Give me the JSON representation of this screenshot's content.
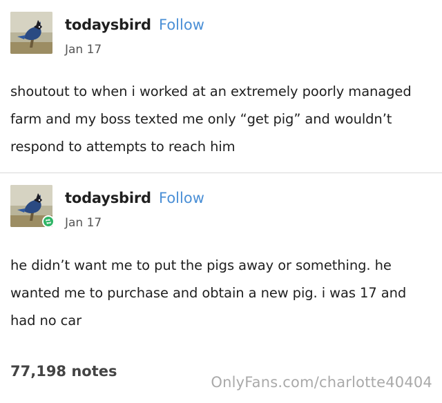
{
  "posts": [
    {
      "username": "todaysbird",
      "follow_label": "Follow",
      "date": "Jan 17",
      "text": "shoutout to when i worked at an extremely poorly managed farm and my boss texted me only “get pig” and wouldn’t respond to attempts to reach him",
      "avatar_icon": "bird-avatar-icon"
    },
    {
      "username": "todaysbird",
      "follow_label": "Follow",
      "date": "Jan 17",
      "text": "he didn’t want me to put the pigs away or something. he wanted me to purchase and obtain a new pig. i was 17 and had no car",
      "avatar_icon": "bird-avatar-icon",
      "badge_icon": "reblog-icon"
    }
  ],
  "notes": "77,198 notes",
  "watermark": "OnlyFans.com/charlotte40404",
  "colors": {
    "follow": "#4a8fd6",
    "reblog_badge": "#2fb566",
    "divider": "#d8d8d8"
  }
}
